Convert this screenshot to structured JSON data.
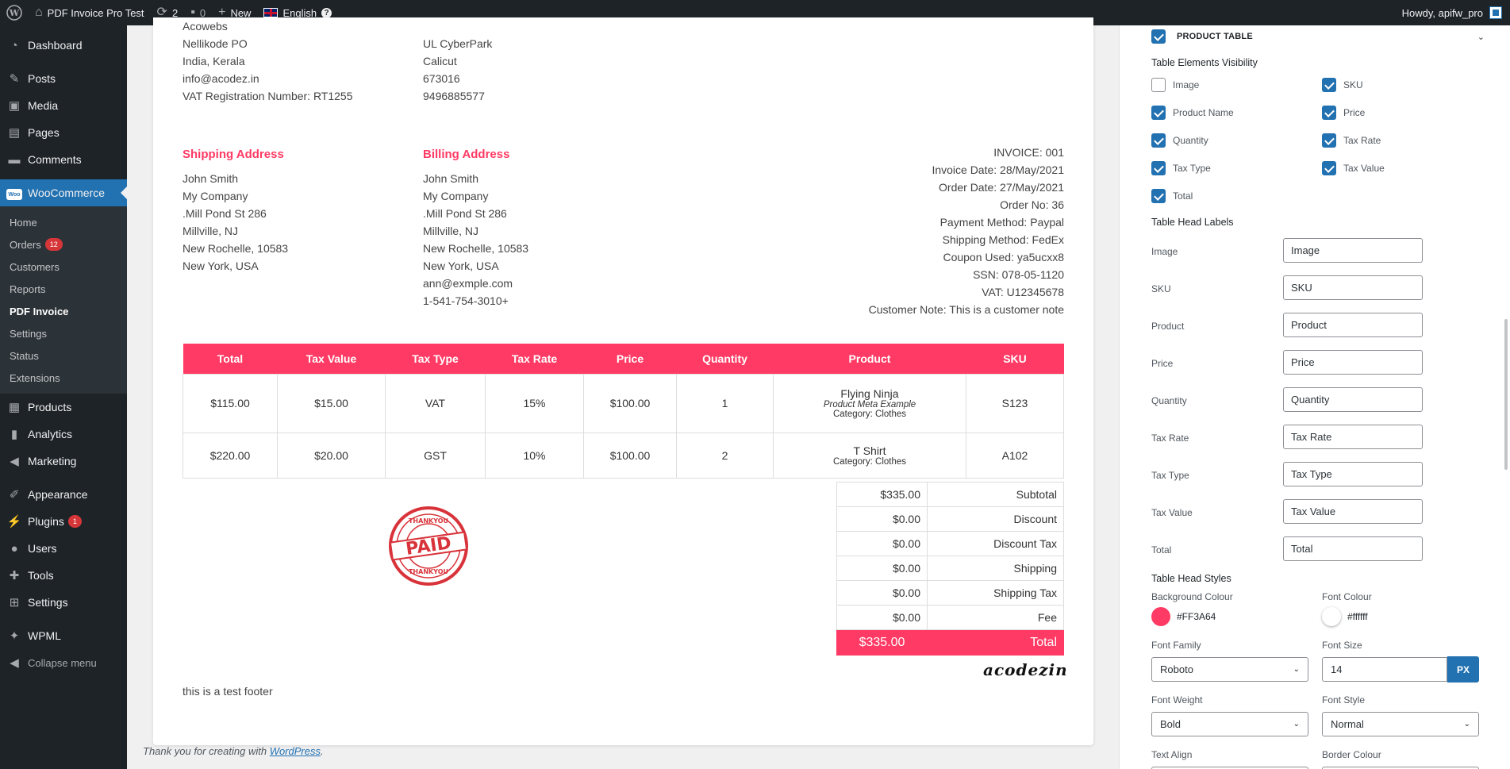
{
  "adminbar": {
    "site_name": "PDF Invoice Pro Test",
    "updates_count": "2",
    "comments_count": "0",
    "new_label": "New",
    "language": "English",
    "howdy": "Howdy, apifw_pro"
  },
  "sidebar": {
    "items_top": [
      {
        "label": "Dashboard",
        "icon": "dashboard-icon"
      },
      {
        "label": "Posts",
        "icon": "pin-icon"
      },
      {
        "label": "Media",
        "icon": "media-icon"
      },
      {
        "label": "Pages",
        "icon": "pages-icon"
      },
      {
        "label": "Comments",
        "icon": "comments-icon"
      }
    ],
    "woocommerce": "WooCommerce",
    "woo_logo_text": "Woo",
    "submenu": [
      {
        "label": "Home"
      },
      {
        "label": "Orders",
        "badge": "12"
      },
      {
        "label": "Customers"
      },
      {
        "label": "Reports"
      },
      {
        "label": "PDF Invoice"
      },
      {
        "label": "Settings"
      },
      {
        "label": "Status"
      },
      {
        "label": "Extensions"
      }
    ],
    "items_mid": [
      {
        "label": "Products"
      },
      {
        "label": "Analytics"
      },
      {
        "label": "Marketing"
      }
    ],
    "items_bottom": [
      {
        "label": "Appearance"
      },
      {
        "label": "Plugins",
        "badge": "1"
      },
      {
        "label": "Users"
      },
      {
        "label": "Tools"
      },
      {
        "label": "Settings"
      }
    ],
    "wpml": "WPML",
    "collapse": "Collapse menu"
  },
  "invoice": {
    "from": [
      "Acowebs",
      "Nellikode PO",
      "India, Kerala",
      "info@acodez.in",
      "VAT Registration Number: RT1255"
    ],
    "to": [
      "UL CyberPark",
      "Calicut",
      "673016",
      "9496885577"
    ],
    "shipping_heading": "Shipping Address",
    "shipping": [
      "John Smith",
      "My Company",
      ".Mill Pond St 286",
      "Millville, NJ",
      "New Rochelle, 10583",
      "New York, USA"
    ],
    "billing_heading": "Billing Address",
    "billing": [
      "John Smith",
      "My Company",
      ".Mill Pond St 286",
      "Millville, NJ",
      "New Rochelle, 10583",
      "New York, USA",
      "ann@exmple.com",
      "1-541-754-3010+"
    ],
    "meta": [
      "INVOICE: 001",
      "Invoice Date: 28/May/2021",
      "Order Date: 27/May/2021",
      "Order No: 36",
      "Payment Method: Paypal",
      "Shipping Method: FedEx",
      "Coupon Used: ya5ucxx8",
      "SSN: 078-05-1120",
      "VAT: U12345678",
      "Customer Note: This is a customer note"
    ],
    "table_headers": [
      "Total",
      "Tax Value",
      "Tax Type",
      "Tax Rate",
      "Price",
      "Quantity",
      "Product",
      "SKU"
    ],
    "rows": [
      {
        "total": "$115.00",
        "tax_value": "$15.00",
        "tax_type": "VAT",
        "tax_rate": "15%",
        "price": "$100.00",
        "quantity": "1",
        "product": "Flying Ninja",
        "product_meta": "Product Meta Example",
        "category": "Category: Clothes",
        "sku": "S123"
      },
      {
        "total": "$220.00",
        "tax_value": "$20.00",
        "tax_type": "GST",
        "tax_rate": "10%",
        "price": "$100.00",
        "quantity": "2",
        "product": "T Shirt",
        "category": "Category: Clothes",
        "sku": "A102"
      }
    ],
    "totals": [
      {
        "value": "$335.00",
        "label": "Subtotal"
      },
      {
        "value": "$0.00",
        "label": "Discount"
      },
      {
        "value": "$0.00",
        "label": "Discount Tax"
      },
      {
        "value": "$0.00",
        "label": "Shipping"
      },
      {
        "value": "$0.00",
        "label": "Shipping Tax"
      },
      {
        "value": "$0.00",
        "label": "Fee"
      }
    ],
    "grand_total": {
      "value": "$335.00",
      "label": "Total"
    },
    "stamp": {
      "main": "PAID",
      "ring": "THANKYOU"
    },
    "signature": "acodezin",
    "footer": "this is a test footer"
  },
  "wp_footer": {
    "prefix": "Thank you for creating with ",
    "link": "WordPress",
    "suffix": "."
  },
  "panel": {
    "section_title": "PRODUCT TABLE",
    "visibility_title": "Table Elements Visibility",
    "visibility": [
      {
        "label": "Image",
        "checked": false
      },
      {
        "label": "SKU",
        "checked": true
      },
      {
        "label": "Product Name",
        "checked": true
      },
      {
        "label": "Price",
        "checked": true
      },
      {
        "label": "Quantity",
        "checked": true
      },
      {
        "label": "Tax Rate",
        "checked": true
      },
      {
        "label": "Tax Type",
        "checked": true
      },
      {
        "label": "Tax Value",
        "checked": true
      },
      {
        "label": "Total",
        "checked": true
      }
    ],
    "labels_title": "Table Head Labels",
    "head_labels": [
      {
        "label": "Image",
        "value": "Image"
      },
      {
        "label": "SKU",
        "value": "SKU"
      },
      {
        "label": "Product",
        "value": "Product"
      },
      {
        "label": "Price",
        "value": "Price"
      },
      {
        "label": "Quantity",
        "value": "Quantity"
      },
      {
        "label": "Tax Rate",
        "value": "Tax Rate"
      },
      {
        "label": "Tax Type",
        "value": "Tax Type"
      },
      {
        "label": "Tax Value",
        "value": "Tax Value"
      },
      {
        "label": "Total",
        "value": "Total"
      }
    ],
    "styles_title": "Table Head Styles",
    "bg_colour_label": "Background Colour",
    "bg_colour": "#FF3A64",
    "font_colour_label": "Font Colour",
    "font_colour": "#ffffff",
    "font_family_label": "Font Family",
    "font_family": "Roboto",
    "font_size_label": "Font Size",
    "font_size": "14",
    "font_size_unit": "PX",
    "font_weight_label": "Font Weight",
    "font_weight": "Bold",
    "font_style_label": "Font Style",
    "font_style": "Normal",
    "text_align_label": "Text Align",
    "border_colour_label": "Border Colour"
  },
  "colors": {
    "accent": "#FF3A64",
    "wp_blue": "#2271b1",
    "admin_dark": "#1d2327"
  }
}
